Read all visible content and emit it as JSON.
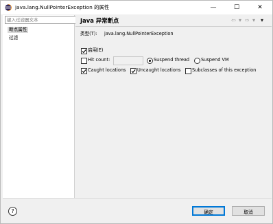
{
  "window": {
    "title": "java.lang.NullPointerException 的属性",
    "minimize_symbol": "—",
    "maximize_symbol": "☐",
    "close_symbol": "✕",
    "icon": "eclipse-icon"
  },
  "sidebar": {
    "filter_placeholder": "键入过滤器文本",
    "items": [
      {
        "label": "断点属性",
        "selected": true
      },
      {
        "label": "过滤",
        "selected": false
      }
    ]
  },
  "page": {
    "title": "Java 异常断点",
    "nav": {
      "back": "⇦",
      "back_menu": "▾",
      "forward": "⇨",
      "forward_menu": "▾",
      "view_menu": "▾"
    },
    "type_label": "类型(T):",
    "type_value": "java.lang.NullPointerException",
    "enabled_label": "启用(E)",
    "enabled_checked": true,
    "hit_count_label": "Hit count:",
    "hit_count_checked": false,
    "hit_count_value": "",
    "suspend_thread_label": "Suspend thread",
    "suspend_vm_label": "Suspend VM",
    "suspend_policy": "thread",
    "caught_label": "Caught locations",
    "caught_checked": true,
    "uncaught_label": "Uncaught locations",
    "uncaught_checked": true,
    "subclasses_label": "Subclasses of this exception",
    "subclasses_checked": false
  },
  "footer": {
    "help_symbol": "?",
    "ok_label": "确定",
    "cancel_label": "取消"
  },
  "colors": {
    "default_button_border": "#0078d7",
    "selection": "#d9d9d9",
    "eclipse_purple": "#2c2255",
    "eclipse_orange": "#f7941e"
  }
}
